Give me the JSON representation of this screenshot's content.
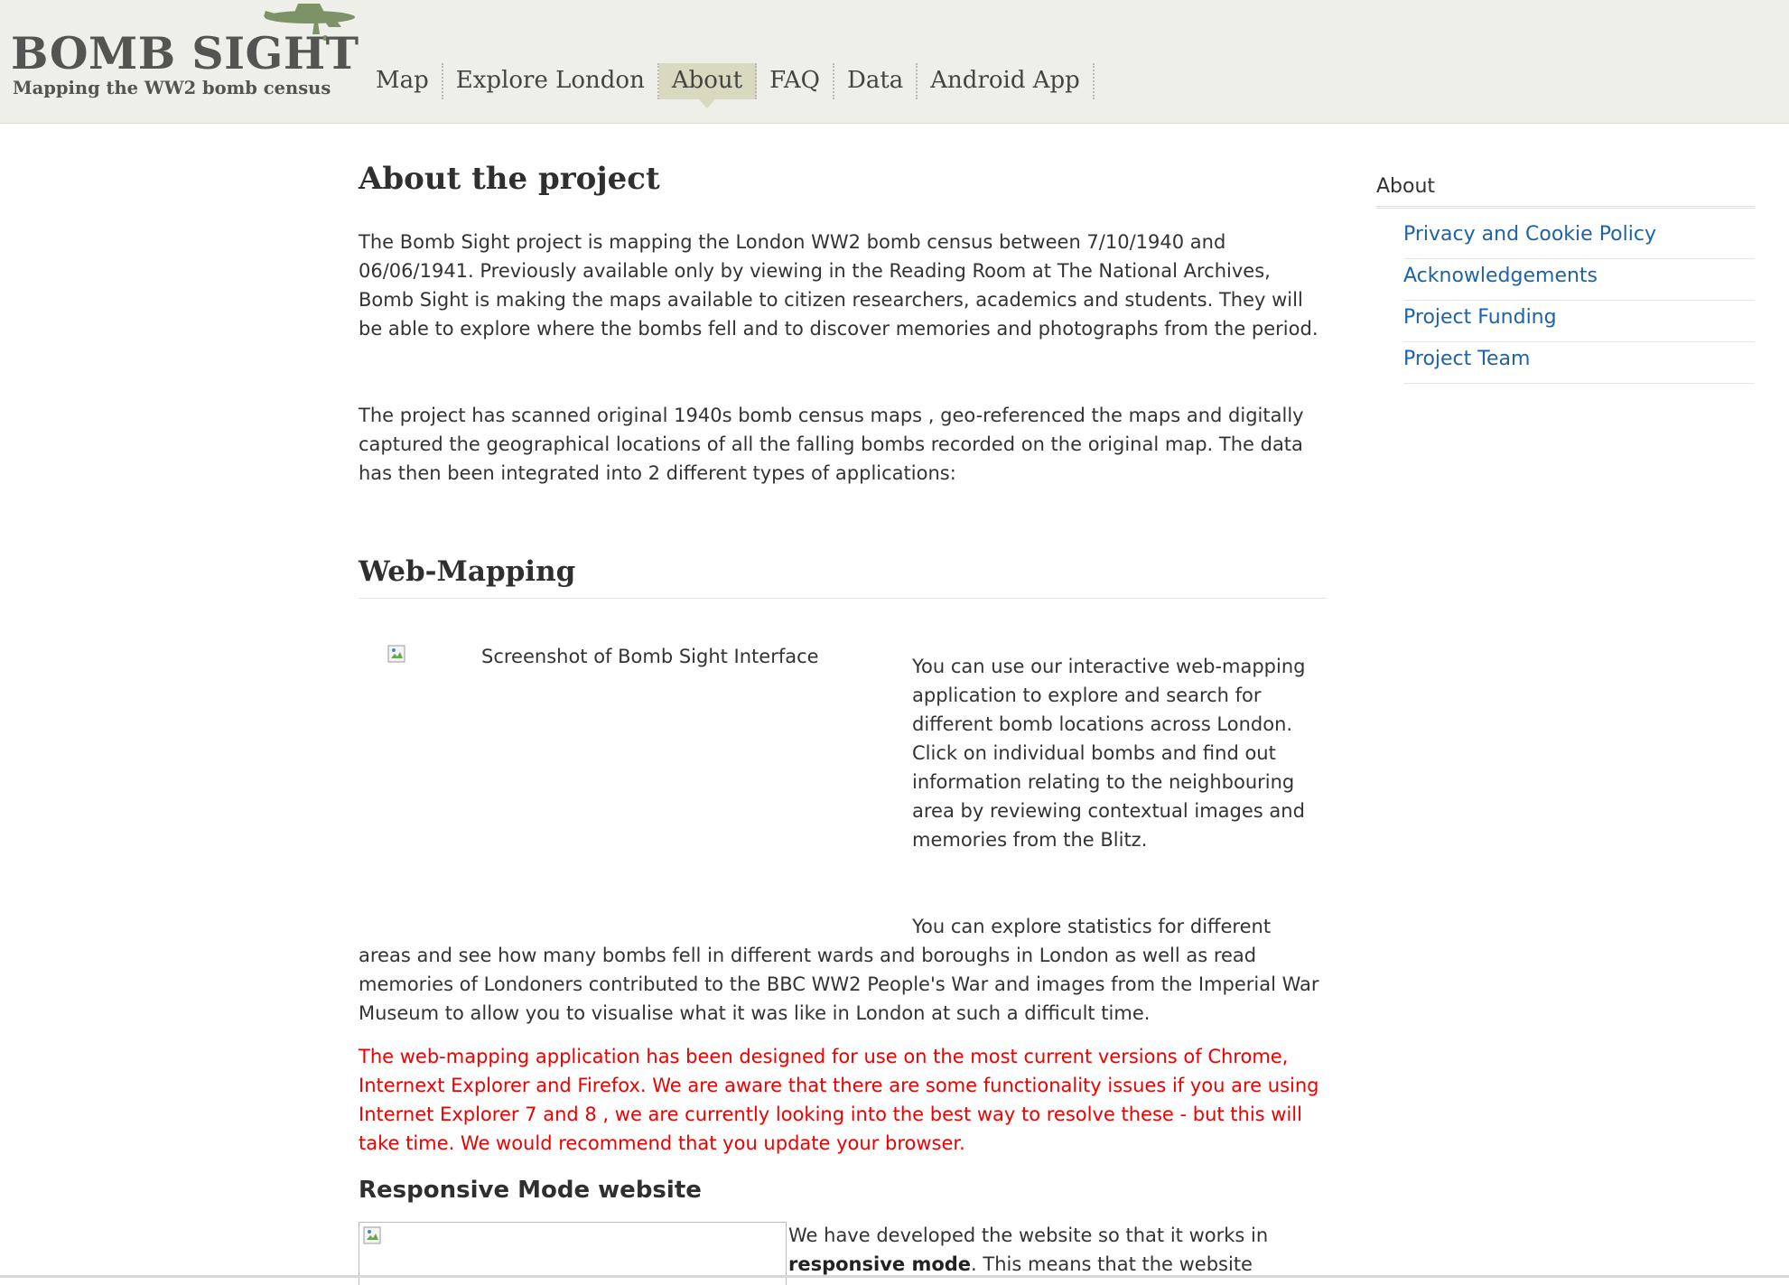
{
  "header": {
    "logo_title": "BOMB SIGHT",
    "logo_subtitle": "Mapping the WW2 bomb census",
    "logo_icon": "plane-icon",
    "nav": [
      {
        "label": "Map",
        "active": false
      },
      {
        "label": "Explore London",
        "active": false
      },
      {
        "label": "About",
        "active": true
      },
      {
        "label": "FAQ",
        "active": false
      },
      {
        "label": "Data",
        "active": false
      },
      {
        "label": "Android App",
        "active": false
      }
    ]
  },
  "main": {
    "title": "About the project",
    "para1": "The Bomb Sight project is mapping the London WW2 bomb census between 7/10/1940 and 06/06/1941. Previously available only by viewing in the Reading Room at The National Archives, Bomb Sight is making the maps available to citizen researchers, academics and students. They will be able to explore where the bombs fell and to discover memories and photographs from the period.",
    "para2": "The project has scanned original 1940s bomb census maps , geo-referenced the maps and digitally captured the geographical locations of all the falling bombs recorded on the original map. The data has then been  integrated into 2 different types of applications:",
    "web_mapping": {
      "heading": "Web-Mapping",
      "image_alt": "Screenshot of Bomb Sight Interface",
      "para1": "You can use our interactive web-mapping application to explore and search for different bomb locations across London. Click on individual bombs and find out information relating to the neighbouring area by reviewing contextual images and memories from the Blitz.",
      "para2": "You can explore statistics for different areas and see how many bombs fell in different wards and boroughs in London as well as read memories of Londoners contributed to the BBC WW2 People's War and images from the Imperial War Museum to allow you to visualise what it was like in London at such a difficult time.",
      "warning": "The web-mapping application has been designed for use on the most current versions of Chrome, Internext Explorer and Firefox. We are aware that there are some functionality issues if you are using Internet Explorer 7 and 8 ,  we are currently looking into the best way to resolve these - but this will take time. We would recommend that you update your browser."
    },
    "responsive": {
      "heading": "Responsive Mode website",
      "text_before": "We have developed the website so that it works in ",
      "text_bold": "responsive mode",
      "text_after": ". This means that the website"
    }
  },
  "sidebar": {
    "title": "About",
    "items": [
      {
        "label": "Privacy and Cookie Policy"
      },
      {
        "label": "Acknowledgements"
      },
      {
        "label": "Project Funding"
      },
      {
        "label": "Project Team"
      }
    ]
  },
  "colors": {
    "header_bg": "#efefe9",
    "nav_active_bg": "#d9d9bf",
    "logo_text": "#545452",
    "plane": "#7d9266",
    "link": "#1f63a6",
    "warning": "#ee0000"
  }
}
